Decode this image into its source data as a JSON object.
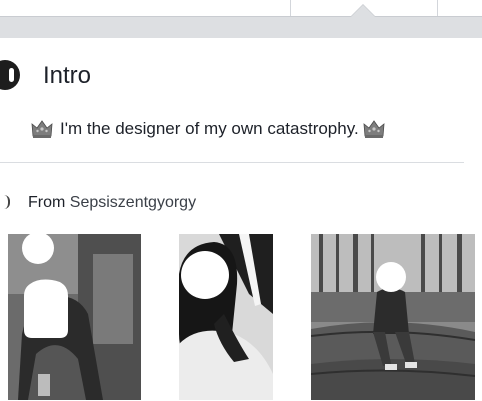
{
  "intro": {
    "title": "Intro",
    "bio": "I'm the designer of my own catastrophy."
  },
  "location": {
    "prefix": "From",
    "place": "Sepsiszentgyorgy"
  },
  "icons": {
    "section": "intro-section-icon",
    "crown": "crown-icon",
    "from": "home-location-icon"
  },
  "colors": {
    "background": "#ffffff",
    "topbar": "#dddfe2",
    "text": "#1d2129",
    "divider": "#dadde1",
    "crown": "#8a8a8a"
  },
  "photos": [
    {
      "label": "featured-photo-1",
      "style": "grayscale"
    },
    {
      "label": "featured-photo-2",
      "style": "grayscale"
    },
    {
      "label": "featured-photo-3",
      "style": "grayscale"
    }
  ]
}
